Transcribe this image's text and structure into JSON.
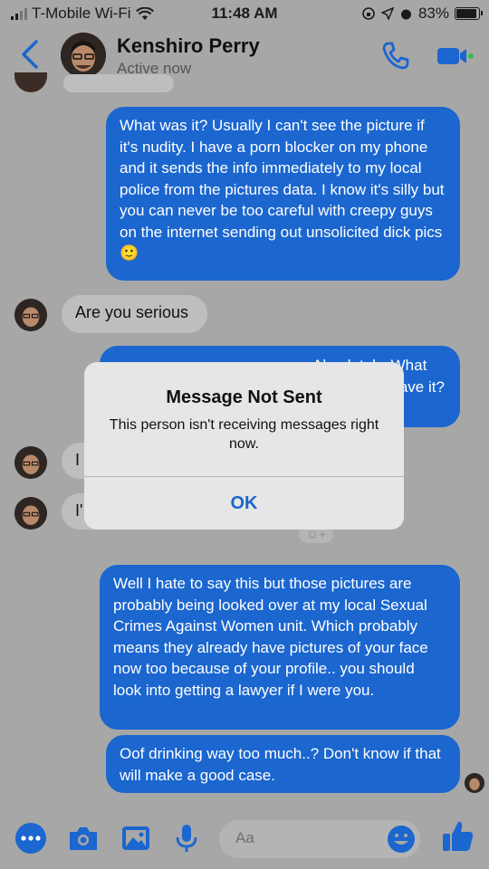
{
  "status_bar": {
    "carrier": "T-Mobile Wi-Fi",
    "time": "11:48 AM",
    "battery": "83%"
  },
  "header": {
    "name": "Kenshiro Perry",
    "status": "Active now"
  },
  "messages": [
    {
      "from": "me",
      "text": "What was it? Usually I can't see the picture if it's nudity. I have a porn blocker on my phone and it sends the info immediately to my local police from the pictures data. I know it's silly but you can never be too careful with creepy guys on the internet sending out unsolicited dick pics 🙂"
    },
    {
      "from": "them",
      "text": "Are you serious"
    },
    {
      "from": "me",
      "text": "Absolutely. What girl doesn't have it? All of … send"
    },
    {
      "from": "them",
      "text": "I"
    },
    {
      "from": "them",
      "text": "I'"
    },
    {
      "from": "me",
      "text": "Well I hate to say this but those pictures are probably being looked over at my local Sexual Crimes Against Women unit. Which probably means they already have pictures of your face now too because of your profile.. you should look into getting a lawyer if I were you."
    },
    {
      "from": "me",
      "text": "Oof drinking way too much..? Don't know if that will make a good case."
    }
  ],
  "alert": {
    "title": "Message Not Sent",
    "message": "This person isn't receiving messages right now.",
    "button": "OK"
  },
  "composer": {
    "placeholder": "Aa"
  },
  "colors": {
    "accent": "#1b66cf",
    "outgoing_bubble": "#1b66cf",
    "incoming_bubble": "#bebebe"
  },
  "icons": [
    "wifi-icon",
    "signal-icon",
    "battery-icon",
    "back-chevron-icon",
    "phone-icon",
    "video-icon",
    "more-icon",
    "camera-icon",
    "gallery-icon",
    "microphone-icon",
    "emoji-icon",
    "thumbs-up-icon"
  ]
}
